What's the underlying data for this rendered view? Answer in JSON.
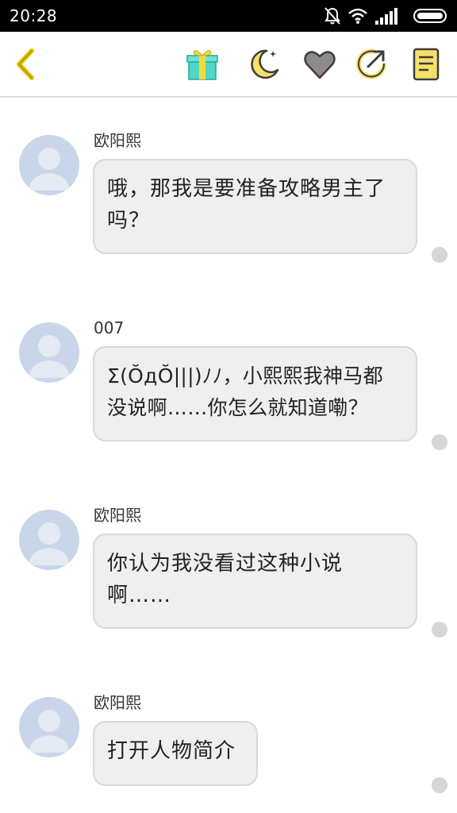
{
  "status_bar": {
    "time": "20:28",
    "icons": [
      "mute-bell-icon",
      "wifi-icon",
      "signal-icon",
      "battery-icon"
    ]
  },
  "toolbar": {
    "icons": [
      "back-arrow-icon",
      "gift-icon",
      "moon-icon",
      "heart-icon",
      "share-icon",
      "notebook-icon"
    ],
    "accent_color": "#e6c200"
  },
  "messages": [
    {
      "sender": "欧阳熙",
      "text": "哦，那我是要准备攻略男主了\n吗？"
    },
    {
      "sender": "007",
      "text": "Σ(ŎдŎ|||)ﾉﾉ，小熙熙我神马都\n没说啊……你怎么就知道嘞？"
    },
    {
      "sender": "欧阳熙",
      "text": "你认为我没看过这种小说\n啊……"
    },
    {
      "sender": "欧阳熙",
      "text": "打开人物简介"
    }
  ]
}
